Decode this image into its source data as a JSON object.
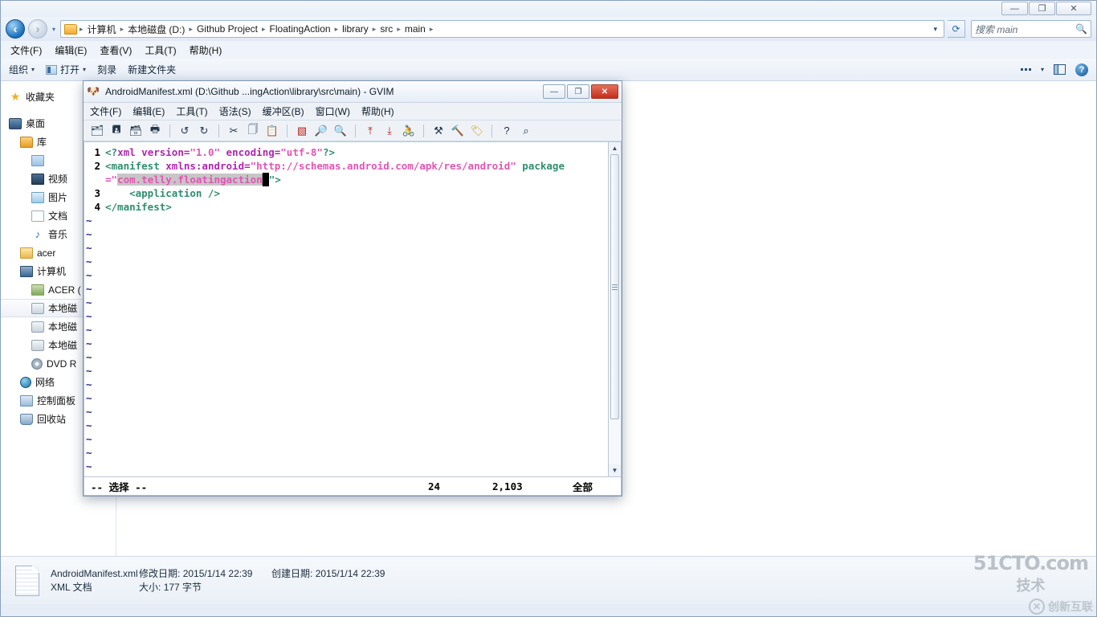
{
  "explorer": {
    "window_buttons": {
      "minimize": "—",
      "maximize": "❐",
      "close": "✕"
    },
    "address": {
      "crumbs": [
        "计算机",
        "本地磁盘 (D:)",
        "Github Project",
        "FloatingAction",
        "library",
        "src",
        "main"
      ],
      "separator": "▸",
      "dropdown_caret": "▾",
      "refresh_icon": "⟳"
    },
    "search": {
      "placeholder": "搜索 main",
      "icon": "search-icon"
    },
    "menubar": [
      "文件(F)",
      "编辑(E)",
      "查看(V)",
      "工具(T)",
      "帮助(H)"
    ],
    "commandbar": {
      "organize": "组织",
      "open": "打开",
      "burn": "刻录",
      "new_folder": "新建文件夹",
      "caret": "▾"
    },
    "navpane": [
      {
        "label": "收藏夹",
        "icon": "star-icon",
        "indent": 0,
        "selected": false
      },
      {
        "label": "桌面",
        "icon": "desktop-icon",
        "indent": 0,
        "selected": false
      },
      {
        "label": "库",
        "icon": "library-folder-icon",
        "indent": 1,
        "selected": false
      },
      {
        "label": "",
        "icon": "subfolder-icon",
        "indent": 2,
        "selected": false
      },
      {
        "label": "视频",
        "icon": "video-icon",
        "indent": 2,
        "selected": false
      },
      {
        "label": "图片",
        "icon": "picture-icon",
        "indent": 2,
        "selected": false
      },
      {
        "label": "文档",
        "icon": "document-icon",
        "indent": 2,
        "selected": false
      },
      {
        "label": "音乐",
        "icon": "music-icon",
        "indent": 2,
        "selected": false
      },
      {
        "label": "acer",
        "icon": "user-icon",
        "indent": 1,
        "selected": false
      },
      {
        "label": "计算机",
        "icon": "computer-icon",
        "indent": 1,
        "selected": false
      },
      {
        "label": "ACER (",
        "icon": "acer-drive-icon",
        "indent": 2,
        "selected": false
      },
      {
        "label": "本地磁",
        "icon": "drive-icon",
        "indent": 2,
        "selected": true
      },
      {
        "label": "本地磁",
        "icon": "drive-icon",
        "indent": 2,
        "selected": false
      },
      {
        "label": "本地磁",
        "icon": "drive-icon",
        "indent": 2,
        "selected": false
      },
      {
        "label": "DVD R",
        "icon": "dvd-drive-icon",
        "indent": 2,
        "selected": false
      },
      {
        "label": "网络",
        "icon": "network-icon",
        "indent": 1,
        "selected": false
      },
      {
        "label": "控制面板",
        "icon": "control-panel-icon",
        "indent": 1,
        "selected": false
      },
      {
        "label": "回收站",
        "icon": "recycle-bin-icon",
        "indent": 1,
        "selected": false
      }
    ],
    "statusbar": {
      "filename": "AndroidManifest.xml",
      "modified_label": "修改日期:",
      "modified_value": "2015/1/14 22:39",
      "created_label": "创建日期:",
      "created_value": "2015/1/14 22:39",
      "filetype": "XML 文档",
      "size_label": "大小:",
      "size_value": "177 字节"
    }
  },
  "gvim": {
    "title": "AndroidManifest.xml (D:\\Github ...ingAction\\library\\src\\main) - GVIM",
    "window_buttons": {
      "minimize": "—",
      "maximize": "❐",
      "close": "✕"
    },
    "menubar": [
      "文件(F)",
      "编辑(E)",
      "工具(T)",
      "语法(S)",
      "缓冲区(B)",
      "窗口(W)",
      "帮助(H)"
    ],
    "toolbar": [
      {
        "name": "open-icon",
        "glyph": "🗁"
      },
      {
        "name": "save-icon",
        "glyph": "🖫"
      },
      {
        "name": "save-all-icon",
        "glyph": "🖫"
      },
      {
        "name": "print-icon",
        "glyph": "🖶"
      },
      {
        "name": "separator",
        "glyph": ""
      },
      {
        "name": "undo-icon",
        "glyph": "↺"
      },
      {
        "name": "redo-icon",
        "glyph": "↻"
      },
      {
        "name": "separator",
        "glyph": ""
      },
      {
        "name": "cut-icon",
        "glyph": "✂"
      },
      {
        "name": "copy-icon",
        "glyph": "🗐"
      },
      {
        "name": "paste-icon",
        "glyph": "📋"
      },
      {
        "name": "separator",
        "glyph": ""
      },
      {
        "name": "find-replace-icon",
        "glyph": "🔤"
      },
      {
        "name": "find-next-icon",
        "glyph": "🔎"
      },
      {
        "name": "find-prev-icon",
        "glyph": "🔍"
      },
      {
        "name": "separator",
        "glyph": ""
      },
      {
        "name": "load-session-icon",
        "glyph": "⤒"
      },
      {
        "name": "save-session-icon",
        "glyph": "⤓"
      },
      {
        "name": "run-script-icon",
        "glyph": "🏃"
      },
      {
        "name": "separator",
        "glyph": ""
      },
      {
        "name": "make-icon",
        "glyph": "⚒"
      },
      {
        "name": "build-tags-icon",
        "glyph": "🔨"
      },
      {
        "name": "jump-tag-icon",
        "glyph": "🏷"
      },
      {
        "name": "separator",
        "glyph": ""
      },
      {
        "name": "help-icon",
        "glyph": "?"
      },
      {
        "name": "find-help-icon",
        "glyph": "⌕"
      }
    ],
    "editor": {
      "lines": [
        {
          "num": "1",
          "spans": [
            {
              "text": "<?",
              "cls": "tag"
            },
            {
              "text": "xml",
              "cls": "attr"
            },
            {
              "text": " version=",
              "cls": "attr"
            },
            {
              "text": "\"1.0\"",
              "cls": "str"
            },
            {
              "text": " encoding=",
              "cls": "attr"
            },
            {
              "text": "\"utf-8\"",
              "cls": "str"
            },
            {
              "text": "?>",
              "cls": "tag"
            }
          ]
        },
        {
          "num": "2",
          "spans": [
            {
              "text": "<manifest ",
              "cls": "tag"
            },
            {
              "text": "xmlns:android=",
              "cls": "attr"
            },
            {
              "text": "\"http://schemas.android.com/apk/res/android\"",
              "cls": "str"
            },
            {
              "text": " package",
              "cls": "tag"
            }
          ]
        },
        {
          "num": "",
          "spans": [
            {
              "text": "=\"",
              "cls": "str"
            },
            {
              "text": "com.telly.floatingaction",
              "cls": "str sel"
            },
            {
              "text": "▌",
              "cls": "cursor"
            },
            {
              "text": "\">",
              "cls": "tag"
            }
          ]
        },
        {
          "num": "3",
          "spans": [
            {
              "text": "    <application />",
              "cls": "tag"
            }
          ]
        },
        {
          "num": "4",
          "spans": [
            {
              "text": "</manifest>",
              "cls": "tag"
            }
          ]
        }
      ],
      "tilde": "~",
      "tilde_count": 19
    },
    "statusline": {
      "mode": "-- 选择 --",
      "line": "24",
      "position": "2,103",
      "scroll": "全部"
    },
    "scrollbar": {
      "up": "▲",
      "down": "▼"
    }
  },
  "watermark": {
    "line1": "51CTO.com",
    "line2": "技术",
    "logo_mark": "✕",
    "logo_text": "创新互联"
  }
}
